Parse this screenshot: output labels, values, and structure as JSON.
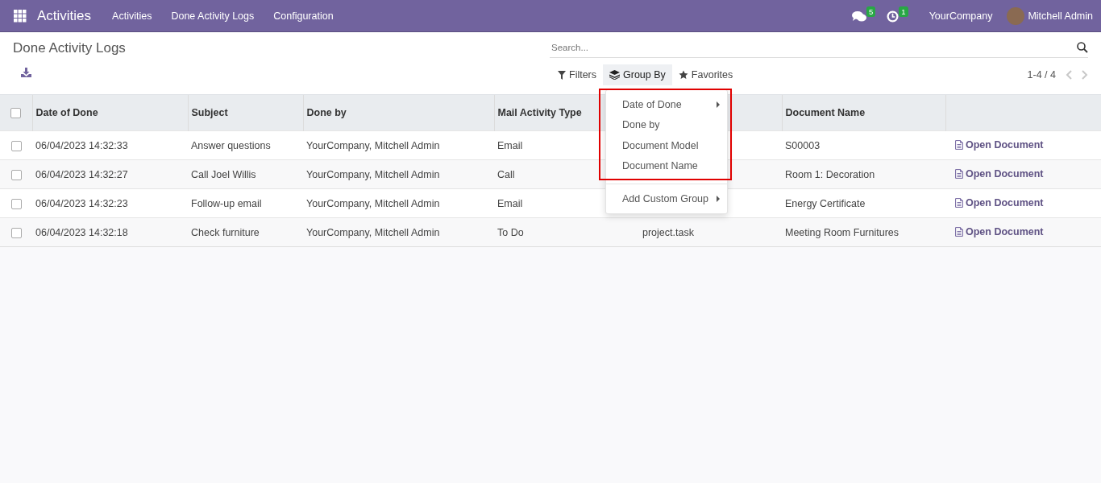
{
  "navbar": {
    "app_name": "Activities",
    "menu": [
      "Activities",
      "Done Activity Logs",
      "Configuration"
    ],
    "messages_count": "5",
    "activities_count": "1",
    "company": "YourCompany",
    "user": "Mitchell Admin"
  },
  "control_panel": {
    "title": "Done Activity Logs",
    "search": {
      "placeholder": "Search..."
    },
    "filters": [
      {
        "kind": "filter",
        "label": "Filters",
        "selected": false
      },
      {
        "kind": "groupby",
        "label": "Group By",
        "selected": true
      },
      {
        "kind": "favorites",
        "label": "Favorites",
        "selected": false
      }
    ],
    "pager": "1-4 / 4"
  },
  "group_by_menu": {
    "items": [
      {
        "label": "Date of Done",
        "kind": "submenu"
      },
      {
        "label": "Done by",
        "kind": "option"
      },
      {
        "label": "Document Model",
        "kind": "option"
      },
      {
        "label": "Document Name",
        "kind": "option"
      }
    ],
    "custom_group": {
      "label": "Add Custom Group",
      "kind": "submenu"
    },
    "highlighted": true
  },
  "table": {
    "all_selected": false,
    "columns": [
      "Date of Done",
      "Subject",
      "Done by",
      "Mail Activity Type",
      null,
      "Document Name"
    ],
    "rows": [
      {
        "selected": false,
        "cells": [
          "06/04/2023 14:32:33",
          "Answer questions",
          "YourCompany, Mitchell Admin",
          "Email",
          null,
          "S00003"
        ],
        "action": "Open Document"
      },
      {
        "selected": false,
        "cells": [
          "06/04/2023 14:32:27",
          "Call Joel Willis",
          "YourCompany, Mitchell Admin",
          "Call",
          null,
          "Room 1: Decoration"
        ],
        "action": "Open Document"
      },
      {
        "selected": false,
        "cells": [
          "06/04/2023 14:32:23",
          "Follow-up email",
          "YourCompany, Mitchell Admin",
          "Email",
          null,
          "Energy Certificate"
        ],
        "action": "Open Document"
      },
      {
        "selected": false,
        "cells": [
          "06/04/2023 14:32:18",
          "Check furniture",
          "YourCompany, Mitchell Admin",
          "To Do",
          "project.task",
          "Meeting Room Furnitures"
        ],
        "action": "Open Document"
      }
    ]
  }
}
